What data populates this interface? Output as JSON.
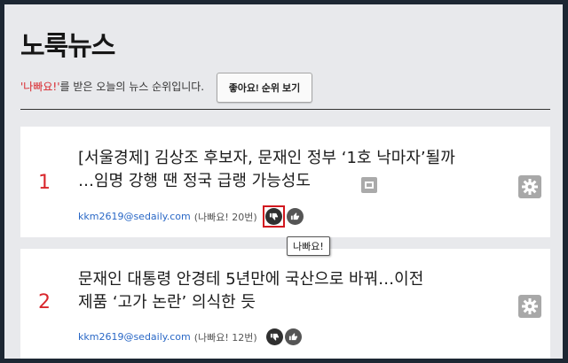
{
  "header": {
    "title": "노룩뉴스",
    "subtitle_highlight": "'나빠요!'",
    "subtitle_rest": "를 받은 오늘의 뉴스 순위입니다.",
    "like_rank_button": "좋아요! 순위 보기"
  },
  "articles": [
    {
      "rank": "1",
      "headline_line1": "[서울경제] 김상조 후보자, 문재인 정부 ‘1호 낙마자’될까",
      "headline_line2": "…임명 강행 땐 정국 급랭 가능성도",
      "email": "kkm2619@sedaily.com",
      "bad_count": "(나빠요! 20번)"
    },
    {
      "rank": "2",
      "headline_line1": "문재인 대통령 안경테 5년만에 국산으로 바꿔…이전",
      "headline_line2": "제품 ‘고가 논란’ 의식한 듯",
      "email": "kkm2619@sedaily.com",
      "bad_count": "(나빠요! 12번)"
    }
  ],
  "tooltip": "나빠요!",
  "icons": {
    "thumb_down": "thumbs-down-icon",
    "thumb_up": "thumbs-up-icon",
    "settings": "gear-icon",
    "image": "image-icon"
  },
  "colors": {
    "rank": "#d9262c",
    "email": "#2a68c6",
    "highlight": "#d9262c",
    "tooltip_target_border": "#d2181f"
  }
}
